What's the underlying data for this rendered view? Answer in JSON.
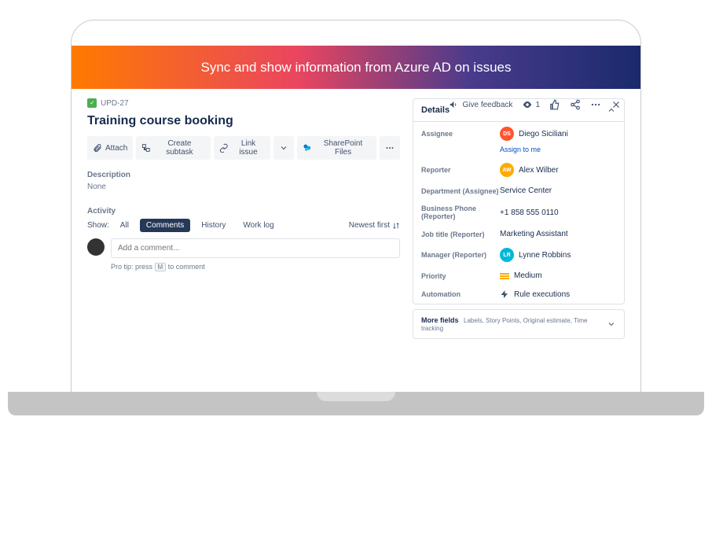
{
  "banner": {
    "title": "Sync and show information from Azure AD on issues"
  },
  "breadcrumb": {
    "key": "UPD-27"
  },
  "issue": {
    "title": "Training course booking"
  },
  "topActions": {
    "feedback": "Give feedback",
    "watchCount": "1"
  },
  "toolbar": {
    "attach": "Attach",
    "subtask": "Create subtask",
    "link": "Link issue",
    "sharepoint": "SharePoint Files"
  },
  "description": {
    "label": "Description",
    "value": "None"
  },
  "activity": {
    "label": "Activity",
    "showLabel": "Show:",
    "tabs": {
      "all": "All",
      "comments": "Comments",
      "history": "History",
      "worklog": "Work log"
    },
    "newest": "Newest first",
    "commentPlaceholder": "Add a comment...",
    "protipPre": "Pro tip: press",
    "protipKey": "M",
    "protipPost": "to comment"
  },
  "details": {
    "heading": "Details",
    "assignee": {
      "label": "Assignee",
      "name": "Diego Siciliani",
      "initials": "DS",
      "assignToMe": "Assign to me"
    },
    "reporter": {
      "label": "Reporter",
      "name": "Alex Wilber",
      "initials": "AW"
    },
    "department": {
      "label": "Department (Assignee)",
      "value": "Service Center"
    },
    "phone": {
      "label": "Business Phone (Reporter)",
      "value": "+1 858 555 0110"
    },
    "jobtitle": {
      "label": "Job title (Reporter)",
      "value": "Marketing Assistant"
    },
    "manager": {
      "label": "Manager (Reporter)",
      "name": "Lynne Robbins",
      "initials": "LR"
    },
    "priority": {
      "label": "Priority",
      "value": "Medium"
    },
    "automation": {
      "label": "Automation",
      "value": "Rule executions"
    }
  },
  "moreFields": {
    "label": "More fields",
    "sub": "Labels, Story Points, Original estimate, Time tracking"
  }
}
